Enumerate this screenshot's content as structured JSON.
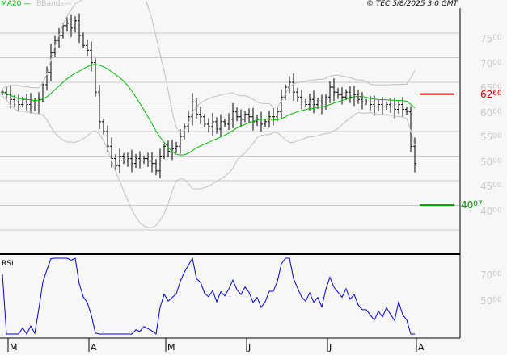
{
  "header": {
    "legend_ma": "MA20",
    "legend_bb": "BBands",
    "copyright": "© TEC 5/8/2025 3:0 GMT"
  },
  "colors": {
    "ma": "#00bb00",
    "bb": "#c0c0c0",
    "price": "#000000",
    "rsi": "#0000cc",
    "resistance": "#cc0000",
    "support": "#009900"
  },
  "chart_data": [
    {
      "type": "line",
      "title": "Price (OHLC bars) with MA20 and Bollinger Bands",
      "y_ticks": [
        [
          "75",
          "00"
        ],
        [
          "70",
          "00"
        ],
        [
          "65",
          "00"
        ],
        [
          "60",
          "00"
        ],
        [
          "55",
          "00"
        ],
        [
          "50",
          "00"
        ],
        [
          "45",
          "00"
        ],
        [
          "40",
          "00"
        ]
      ],
      "y_tick_values": [
        7500,
        7000,
        6500,
        6000,
        5500,
        5000,
        4500,
        4000
      ],
      "ylim": [
        3500,
        7800
      ],
      "x_month_labels": [
        "M",
        "A",
        "M",
        "J",
        "J",
        "A"
      ],
      "x_month_index": [
        1,
        21,
        40,
        60,
        80,
        102
      ],
      "closes": [
        6300,
        6250,
        6150,
        6100,
        6050,
        6150,
        6050,
        6100,
        6000,
        6150,
        6450,
        6700,
        7100,
        7350,
        7450,
        7650,
        7700,
        7600,
        7750,
        7450,
        7250,
        7150,
        6900,
        6300,
        5700,
        5500,
        5200,
        4950,
        4800,
        5000,
        4900,
        4950,
        4850,
        4950,
        4900,
        4950,
        4900,
        4850,
        4700,
        5000,
        5200,
        5100,
        5150,
        5200,
        5400,
        5600,
        5800,
        6100,
        5850,
        5800,
        5650,
        5600,
        5700,
        5550,
        5700,
        5650,
        5750,
        5900,
        5800,
        5750,
        5850,
        5800,
        5700,
        5750,
        5650,
        5700,
        5800,
        5800,
        5900,
        6200,
        6400,
        6500,
        6300,
        6200,
        6100,
        6050,
        6150,
        6050,
        6100,
        6000,
        6200,
        6400,
        6300,
        6250,
        6200,
        6300,
        6200,
        6250,
        6150,
        6100,
        6100,
        6050,
        6000,
        6050,
        6000,
        6050,
        6000,
        5950,
        6050,
        5950,
        5900,
        5200,
        4850
      ],
      "levels": [
        {
          "name": "resistance",
          "value": 6260,
          "label": [
            "62",
            "60"
          ]
        },
        {
          "name": "support",
          "value": 4007,
          "label": [
            "40",
            "07"
          ]
        }
      ],
      "series": [
        {
          "name": "MA20"
        },
        {
          "name": "BBands"
        }
      ]
    },
    {
      "type": "line",
      "title": "RSI",
      "y_ticks": [
        [
          "70",
          "00"
        ],
        [
          "50",
          "00"
        ]
      ],
      "y_tick_values": [
        70,
        50
      ]
    }
  ]
}
